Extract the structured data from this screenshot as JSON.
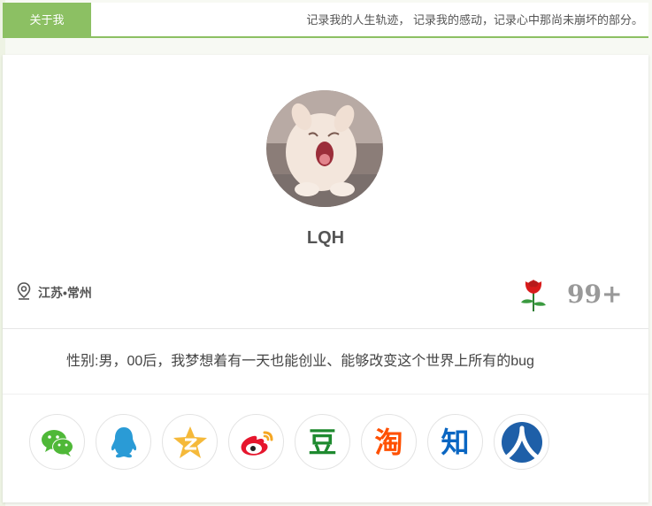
{
  "header": {
    "tab_label": "关于我",
    "motto": "记录我的人生轨迹， 记录我的感动，记录心中那尚未崩坏的部分。"
  },
  "profile": {
    "name": "LQH",
    "location": "江苏•常州",
    "count": "99+",
    "bio": "性别:男，00后，我梦想着有一天也能创业、能够改变这个世界上所有的bug"
  },
  "socials": [
    {
      "name": "wechat-icon",
      "color": "#4fb838"
    },
    {
      "name": "qq-icon",
      "color": "#2a9bd6"
    },
    {
      "name": "qzone-icon",
      "color": "#f5b93a"
    },
    {
      "name": "weibo-icon",
      "color": "#e6162d"
    },
    {
      "name": "douban-icon",
      "glyph": "豆",
      "color": "#1e8a2f"
    },
    {
      "name": "taobao-icon",
      "glyph": "淘",
      "color": "#ff5000"
    },
    {
      "name": "zhihu-icon",
      "glyph": "知",
      "color": "#0a66c2"
    },
    {
      "name": "renren-icon",
      "color": "#1e5fa8"
    }
  ],
  "colors": {
    "accent": "#8cc063"
  }
}
